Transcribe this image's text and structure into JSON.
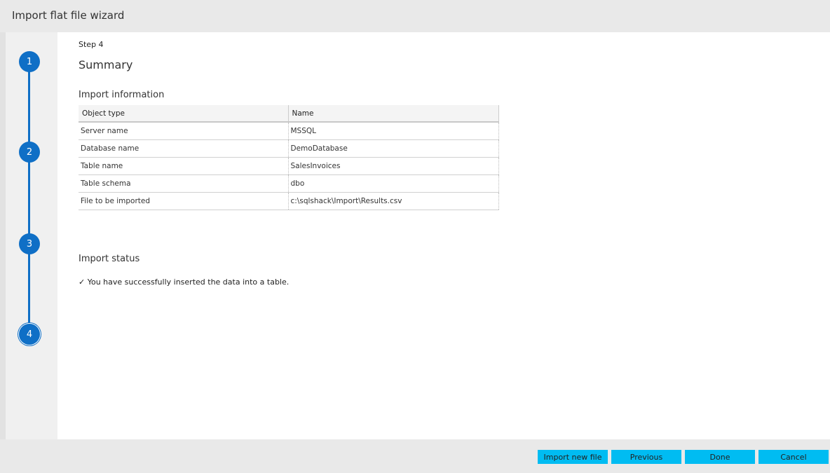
{
  "window": {
    "title": "Import flat file wizard"
  },
  "steps": [
    "1",
    "2",
    "3",
    "4"
  ],
  "main": {
    "step_label": "Step 4",
    "page_title": "Summary",
    "import_info_heading": "Import information",
    "columns": [
      "Object type",
      "Name"
    ],
    "rows": [
      [
        "Server name",
        "MSSQL"
      ],
      [
        "Database name",
        "DemoDatabase"
      ],
      [
        "Table name",
        "SalesInvoices"
      ],
      [
        "Table schema",
        "dbo"
      ],
      [
        "File to be imported",
        "c:\\sqlshack\\Import\\Results.csv"
      ]
    ],
    "import_status_heading": "Import status",
    "status_icon": "✓",
    "status_message": "You have successfully inserted the data into a table."
  },
  "footer": {
    "import_new": "Import new file",
    "previous": "Previous",
    "done": "Done",
    "cancel": "Cancel"
  },
  "colors": {
    "accent": "#0f6fc6",
    "button": "#00bcf2"
  }
}
